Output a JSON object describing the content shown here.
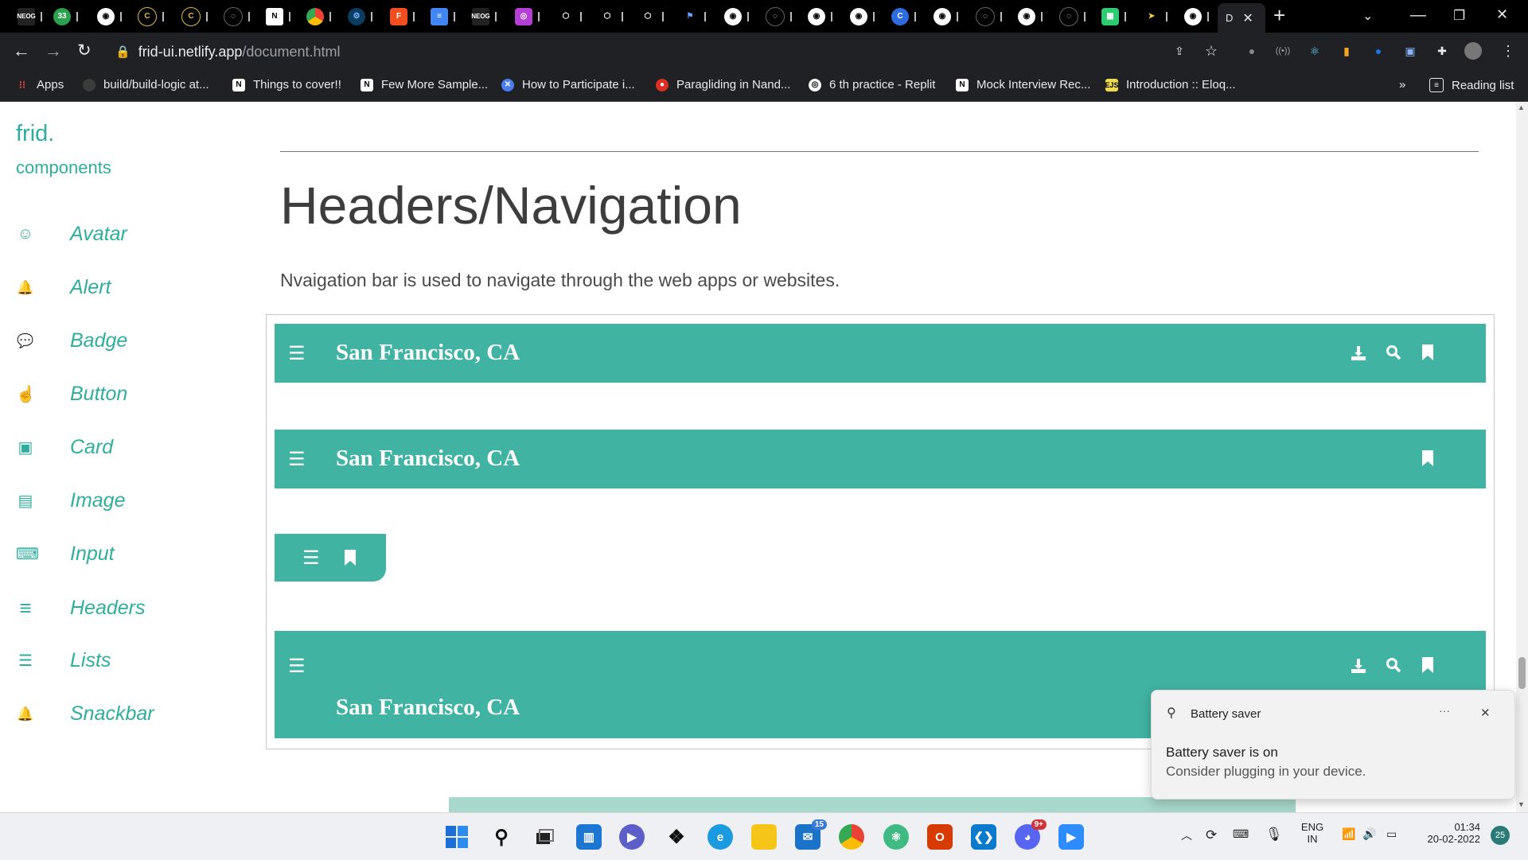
{
  "browser": {
    "url_host": "frid-ui.netlify.app",
    "url_path": "/document.html",
    "active_tab_initial": "D",
    "reading_list_label": "Reading list",
    "bookmarks_overflow": "»"
  },
  "bookmarks": [
    {
      "label": "Apps",
      "icon": "apps-grid-icon",
      "color": "#e8453c"
    },
    {
      "label": "build/build-logic at...",
      "icon": "github-icon",
      "color": "#3c3c3c"
    },
    {
      "label": "Things to cover!!",
      "icon": "notion-icon",
      "color": "#ffffff"
    },
    {
      "label": "Few More Sample...",
      "icon": "notion-icon",
      "color": "#ffffff"
    },
    {
      "label": "How to Participate i...",
      "icon": "globe-icon",
      "color": "#4a7cf0"
    },
    {
      "label": "Paragliding in Nand...",
      "icon": "record-icon",
      "color": "#d93025"
    },
    {
      "label": "6 th practice - Replit",
      "icon": "replit-icon",
      "color": "#ffffff"
    },
    {
      "label": "Mock Interview Rec...",
      "icon": "notion-icon",
      "color": "#ffffff"
    },
    {
      "label": "Introduction :: Eloq...",
      "icon": "js-icon",
      "color": "#f0db4f"
    }
  ],
  "sidebar": {
    "brand": "frid.",
    "subtitle": "components",
    "items": [
      {
        "label": "Avatar",
        "icon": "user-circle-icon",
        "glyph": "☺"
      },
      {
        "label": "Alert",
        "icon": "bell-icon",
        "glyph": "🔔"
      },
      {
        "label": "Badge",
        "icon": "comment-icon",
        "glyph": "💬"
      },
      {
        "label": "Button",
        "icon": "hand-pointer-icon",
        "glyph": "☝"
      },
      {
        "label": "Card",
        "icon": "id-card-icon",
        "glyph": "▣"
      },
      {
        "label": "Image",
        "icon": "images-icon",
        "glyph": "▤"
      },
      {
        "label": "Input",
        "icon": "keyboard-icon",
        "glyph": "⌨"
      },
      {
        "label": "Headers",
        "icon": "bars-icon",
        "glyph": "≡"
      },
      {
        "label": "Lists",
        "icon": "list-icon",
        "glyph": "☰"
      },
      {
        "label": "Snackbar",
        "icon": "bell-icon",
        "glyph": "🔔"
      }
    ]
  },
  "main": {
    "title": "Headers/Navigation",
    "description": "Nvaigation bar is used to navigate through the web apps or websites.",
    "nav_demos": [
      {
        "city": "San Francisco, CA",
        "actions": [
          "download-icon",
          "search-icon",
          "bookmark-icon"
        ]
      },
      {
        "city": "San Francisco, CA",
        "actions": [
          "bookmark-icon"
        ]
      },
      {
        "city": "",
        "actions": [
          "bookmark-icon"
        ]
      },
      {
        "city": "San Francisco, CA",
        "actions": [
          "download-icon",
          "search-icon",
          "bookmark-icon"
        ]
      }
    ]
  },
  "toast": {
    "title": "Battery saver",
    "line1": "Battery saver is on",
    "line2": "Consider plugging in your device.",
    "more": "···",
    "close": "✕"
  },
  "taskbar": {
    "mail_badge": "15",
    "discord_badge": "9+",
    "lang_top": "ENG",
    "lang_bottom": "IN",
    "time": "01:34",
    "date": "20-02-2022",
    "notifications": "25"
  },
  "colors": {
    "accent": "#2fae9d",
    "navbar": "#41b3a3"
  }
}
